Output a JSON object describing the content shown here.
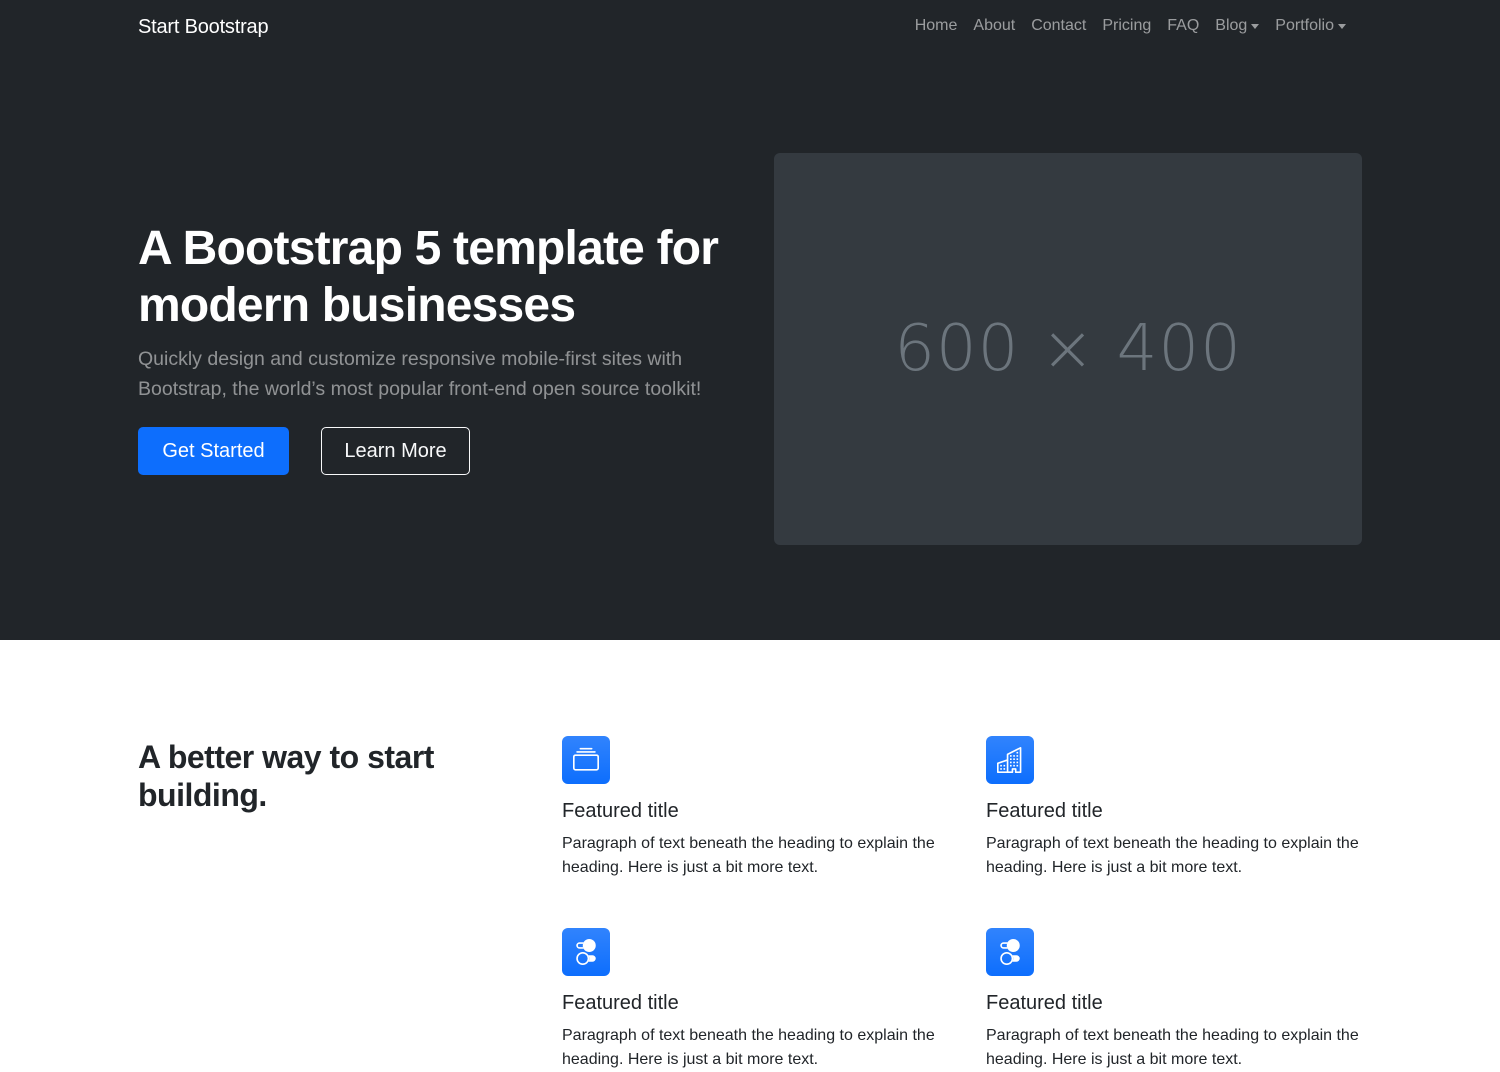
{
  "navbar": {
    "brand": "Start Bootstrap",
    "links": [
      {
        "label": "Home",
        "dropdown": false
      },
      {
        "label": "About",
        "dropdown": false
      },
      {
        "label": "Contact",
        "dropdown": false
      },
      {
        "label": "Pricing",
        "dropdown": false
      },
      {
        "label": "FAQ",
        "dropdown": false
      },
      {
        "label": "Blog",
        "dropdown": true
      },
      {
        "label": "Portfolio",
        "dropdown": true
      }
    ]
  },
  "hero": {
    "title": "A Bootstrap 5 template for modern businesses",
    "lead": "Quickly design and customize responsive mobile-first sites with Bootstrap, the world’s most popular front-end open source toolkit!",
    "primary_button": "Get Started",
    "secondary_button": "Learn More",
    "image_placeholder": "600 × 400"
  },
  "features": {
    "heading": "A better way to start building.",
    "items": [
      {
        "icon": "collection-icon",
        "title": "Featured title",
        "text": "Paragraph of text beneath the heading to explain the heading. Here is just a bit more text."
      },
      {
        "icon": "building-icon",
        "title": "Featured title",
        "text": "Paragraph of text beneath the heading to explain the heading. Here is just a bit more text."
      },
      {
        "icon": "toggles-icon",
        "title": "Featured title",
        "text": "Paragraph of text beneath the heading to explain the heading. Here is just a bit more text."
      },
      {
        "icon": "toggles-icon",
        "title": "Featured title",
        "text": "Paragraph of text beneath the heading to explain the heading. Here is just a bit more text."
      }
    ]
  },
  "colors": {
    "dark_bg": "#212529",
    "placeholder_bg": "#343a40",
    "primary": "#0d6efd",
    "muted_text": "#6c757d"
  }
}
